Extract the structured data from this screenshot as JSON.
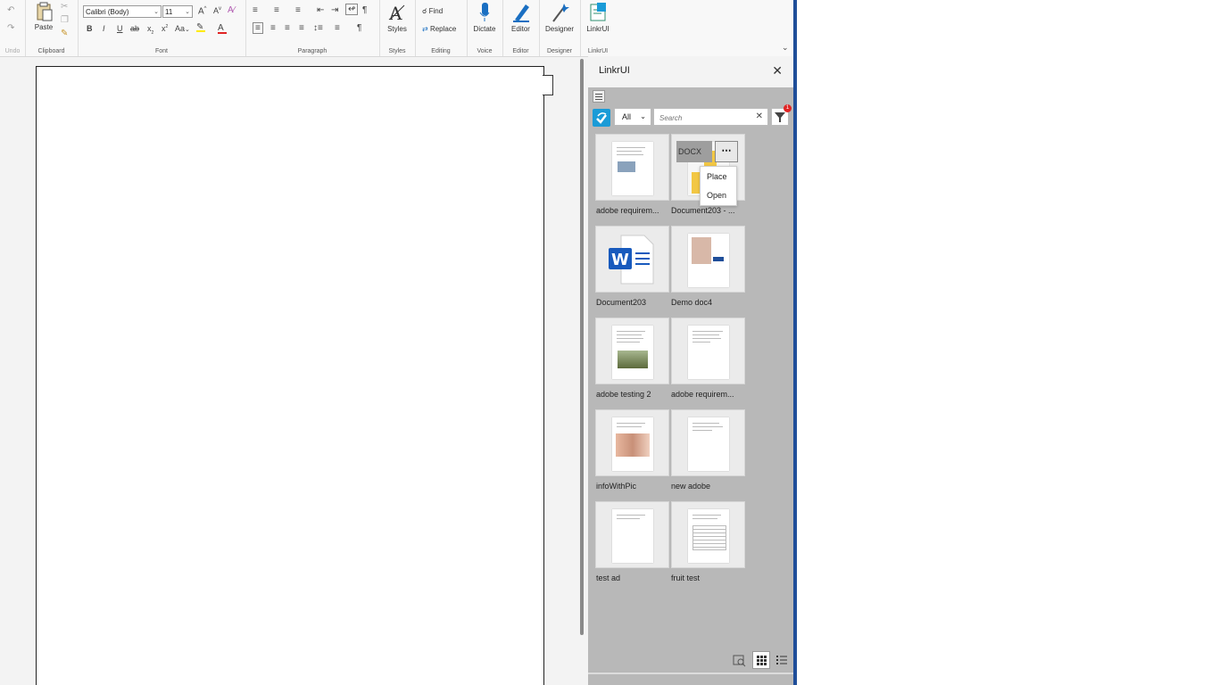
{
  "ribbon": {
    "undo_label": "Undo",
    "clipboard": {
      "paste_label": "Paste",
      "group_label": "Clipboard"
    },
    "font": {
      "font_name": "Calibri (Body)",
      "font_size": "11",
      "group_label": "Font",
      "change_case": "Aa"
    },
    "paragraph": {
      "group_label": "Paragraph"
    },
    "styles": {
      "label": "Styles",
      "group_label": "Styles"
    },
    "editing": {
      "find_label": "Find",
      "replace_label": "Replace",
      "group_label": "Editing"
    },
    "voice": {
      "dictate_label": "Dictate",
      "group_label": "Voice"
    },
    "editor": {
      "label": "Editor",
      "group_label": "Editor"
    },
    "designer": {
      "label": "Designer",
      "group_label": "Designer"
    },
    "linkrui": {
      "label": "LinkrUI",
      "group_label": "LinkrUI"
    }
  },
  "pane": {
    "title": "LinkrUI",
    "scope": "All",
    "search_placeholder": "Search",
    "filter_count": "1",
    "docx_tag": "DOCX",
    "context_menu": [
      "Place",
      "Open"
    ],
    "tiles": [
      {
        "label": "adobe requirem...",
        "thumb": "doc-with-image"
      },
      {
        "label": "Document203 - ...",
        "thumb": "docx-yellow"
      },
      {
        "label": "Document203",
        "thumb": "word-icon"
      },
      {
        "label": "Demo doc4",
        "thumb": "doc-with-photo"
      },
      {
        "label": "adobe testing 2",
        "thumb": "doc-with-landscape"
      },
      {
        "label": "adobe requirem...",
        "thumb": "doc-text"
      },
      {
        "label": "infoWithPic",
        "thumb": "doc-with-people"
      },
      {
        "label": "new adobe",
        "thumb": "doc-text"
      },
      {
        "label": "test ad",
        "thumb": "doc-text"
      },
      {
        "label": "fruit test",
        "thumb": "doc-with-table"
      }
    ]
  },
  "colors": {
    "accent": "#1a9bd7",
    "word_blue": "#185abd",
    "badge_red": "#e02424",
    "window_border": "#1f4e99"
  }
}
